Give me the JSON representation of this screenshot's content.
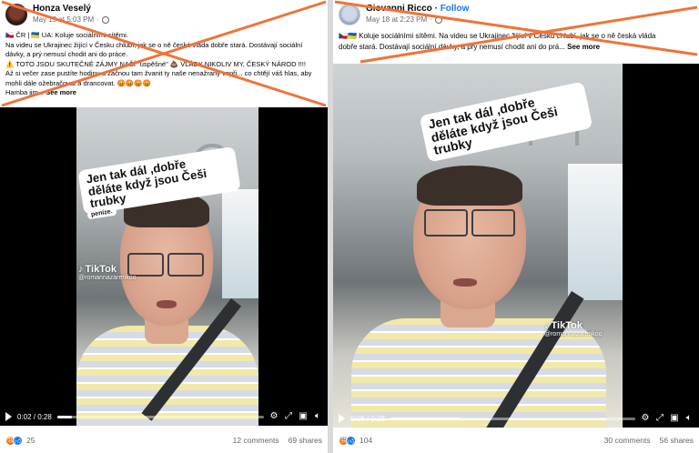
{
  "left_post": {
    "author": "Honza Veselý",
    "timestamp": "May 19 at 5:03 PM",
    "text_lines": [
      "🇨🇿 ČR | 🇺🇦 UA: Koluje sociálními sítěmi.",
      "Na videu se Ukrajinec žijící v Česku chlubí, jak se o ně česká vláda dobře stará. Dostávají sociální",
      "dávky, a prý nemusí chodit ani do práce.",
      "⚠️ TOTO JSOU SKUTEČNÉ ZÁJMY NAŠÍ \"úspěšné\" 💩 VLÁDY NIKOLIV MY, ČESKÝ NÁROD !!!!",
      "Až si večer zase pustíte hodinu a začnou tam žvanit ty naše nenažraný vepři... co chtějí váš hlas, aby",
      "mohli dále ožebračovat a drancovat. 😡😡😡😡"
    ],
    "last_line_prefix": "Hamba jim...",
    "see_more": "See more",
    "video": {
      "caption": "Jen tak dál ,dobře\nděláte když jsou Češi\ntrubky",
      "caption_small": "peníze.",
      "tiktok_brand": "TikTok",
      "tiktok_handle": "@romannazarenkoo",
      "time": "0:02 / 0:28",
      "progress": 0.07
    },
    "reaction_count": "25",
    "comments": "12 comments",
    "shares": "69 shares"
  },
  "right_post": {
    "author": "Giovanni Ricco",
    "follow_label": "Follow",
    "timestamp": "May 18 at 2:23 PM",
    "text_lines": [
      "🇨🇿🇺🇦 Koluje sociálními sítěmi. Na videu se Ukrajinec žijící v Česku chlubí, jak se o ně česká vláda"
    ],
    "last_line_prefix": "dobře stará. Dostávají sociální dávky, a prý nemusí chodit ani do prá...",
    "see_more": "See more",
    "video": {
      "caption": "Jen tak dál ,dobře\nděláte když jsou Češi\ntrubky",
      "tiktok_brand": "TikTok",
      "tiktok_handle": "@romannazarenkoo",
      "time": "0:08 / 0:28",
      "progress": 0.29
    },
    "reaction_count": "104",
    "comments": "30 comments",
    "shares": "56 shares"
  },
  "icons": {
    "play": "play-icon",
    "settings": "gear-icon",
    "pip": "picture-in-picture-icon",
    "fullscreen": "fullscreen-icon",
    "volume": "volume-icon",
    "reaction_angry": "angry-reaction-icon",
    "reaction_like": "like-reaction-icon"
  },
  "colors": {
    "cross": "#f0733a",
    "facebook_blue": "#1877f2",
    "angry": "#e9710f"
  }
}
